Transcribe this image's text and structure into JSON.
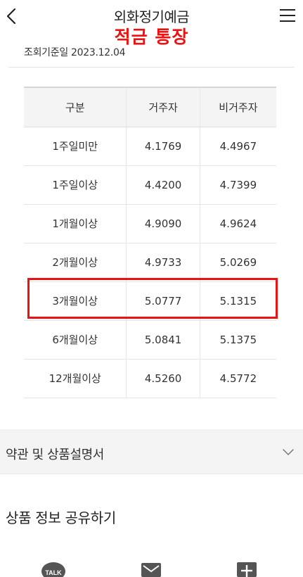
{
  "header": {
    "title": "외화정기예금",
    "overlay_label": "적금 통장"
  },
  "date_line": "조회기준일 2023.12.04",
  "table": {
    "headers": [
      "구분",
      "거주자",
      "비거주자"
    ],
    "rows": [
      {
        "period": "1주일미만",
        "resident": "4.1769",
        "nonresident": "4.4967"
      },
      {
        "period": "1주일이상",
        "resident": "4.4200",
        "nonresident": "4.7399"
      },
      {
        "period": "1개월이상",
        "resident": "4.9090",
        "nonresident": "4.9624"
      },
      {
        "period": "2개월이상",
        "resident": "4.9733",
        "nonresident": "5.0269"
      },
      {
        "period": "3개월이상",
        "resident": "5.0777",
        "nonresident": "5.1315"
      },
      {
        "period": "6개월이상",
        "resident": "5.0841",
        "nonresident": "5.1375"
      },
      {
        "period": "12개월이상",
        "resident": "4.5260",
        "nonresident": "4.5772"
      }
    ]
  },
  "accordion": {
    "label": "약관 및 상품설명서"
  },
  "share": {
    "title": "상품 정보 공유하기",
    "kakao_label": "TALK"
  },
  "icons": {
    "back": "chevron-left-icon",
    "menu": "hamburger-menu-icon",
    "accordion": "chevron-down-icon",
    "kakao": "kakaotalk-icon",
    "email": "mail-icon",
    "more": "plus-icon"
  },
  "colors": {
    "highlight": "#ee1111",
    "overlay_label": "#ee1111",
    "table_header_bg": "#f4f4f4"
  }
}
